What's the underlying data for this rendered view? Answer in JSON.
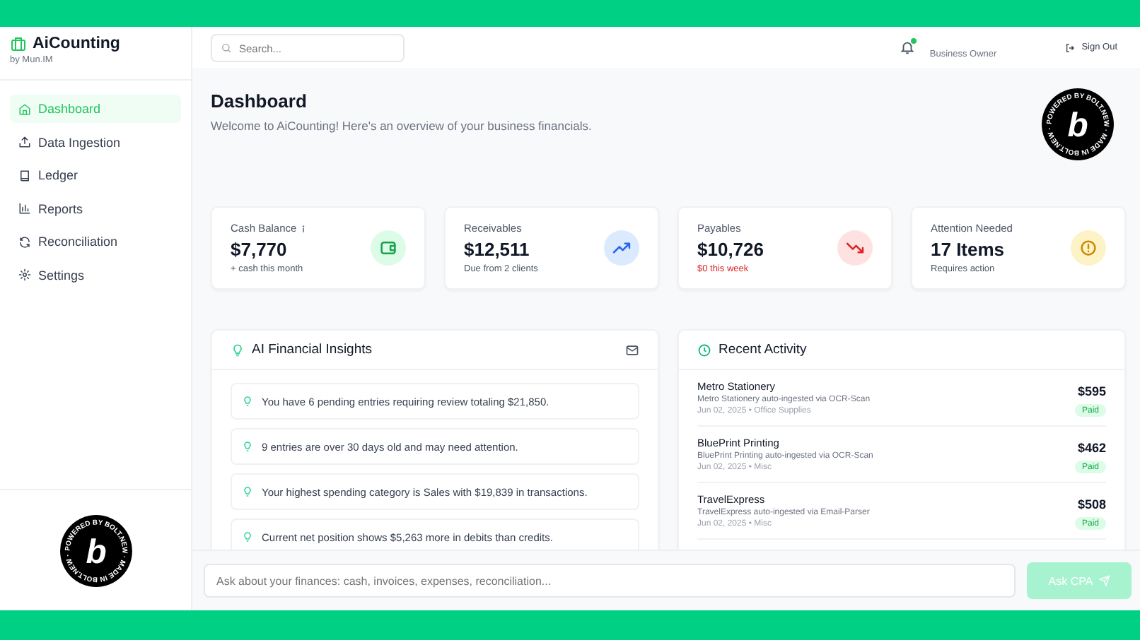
{
  "brand": {
    "name": "AiCounting",
    "byline": "by Mun.IM"
  },
  "sidebar": {
    "items": [
      {
        "label": "Dashboard",
        "selected": true
      },
      {
        "label": "Data Ingestion",
        "selected": false
      },
      {
        "label": "Ledger",
        "selected": false
      },
      {
        "label": "Reports",
        "selected": false
      },
      {
        "label": "Reconciliation",
        "selected": false
      },
      {
        "label": "Settings",
        "selected": false
      }
    ]
  },
  "header_badge": {
    "letter": "b",
    "ring_text": "POWERED BY BOLT.NEW · MADE IN BOLT.NEW ·"
  },
  "sidebar_badge": {
    "letter": "b",
    "ring_text": "POWERED BY BOLT.NEW · MADE IN BOLT.NEW ·"
  },
  "topbar": {
    "search": {
      "placeholder": "Search..."
    },
    "has_unread": true,
    "role": "Business Owner",
    "sign_out": "Sign Out"
  },
  "page": {
    "title": "Dashboard",
    "subtitle": "Welcome to AiCounting! Here's an overview of your business financials."
  },
  "stats": [
    {
      "label": "Cash Balance",
      "info": true,
      "value": "$7,770",
      "note": "+ cash this month",
      "warning": false,
      "kind": "wallet"
    },
    {
      "label": "Receivables",
      "info": false,
      "value": "$12,511",
      "note": "Due from 2 clients",
      "warning": false,
      "kind": "up"
    },
    {
      "label": "Payables",
      "info": false,
      "value": "$10,726",
      "note": "$0 this week",
      "warning": true,
      "kind": "down"
    },
    {
      "label": "Attention Needed",
      "info": false,
      "value": "17 Items",
      "note": "Requires action",
      "warning": false,
      "kind": "alert"
    }
  ],
  "insights": {
    "title": "AI Financial Insights",
    "items": [
      "You have 6 pending entries requiring review totaling $21,850.",
      "9 entries are over 30 days old and may need attention.",
      "Your highest spending category is Sales with $19,839 in transactions.",
      "Current net position shows $5,263 more in debits than credits."
    ]
  },
  "activity": {
    "title": "Recent Activity",
    "items": [
      {
        "name": "Metro Stationery",
        "detail": "Metro Stationery auto-ingested via OCR-Scan",
        "meta": "Jun 02, 2025 • Office Supplies",
        "amount": "$595",
        "status": "Paid"
      },
      {
        "name": "BluePrint Printing",
        "detail": "BluePrint Printing auto-ingested via OCR-Scan",
        "meta": "Jun 02, 2025 • Misc",
        "amount": "$462",
        "status": "Paid"
      },
      {
        "name": "TravelExpress",
        "detail": "TravelExpress auto-ingested via Email-Parser",
        "meta": "Jun 02, 2025 • Misc",
        "amount": "$508",
        "status": "Paid"
      }
    ]
  },
  "chat": {
    "placeholder": "Ask about your finances: cash, invoices, expenses, reconciliation...",
    "button": "Ask CPA",
    "disabled": true
  }
}
